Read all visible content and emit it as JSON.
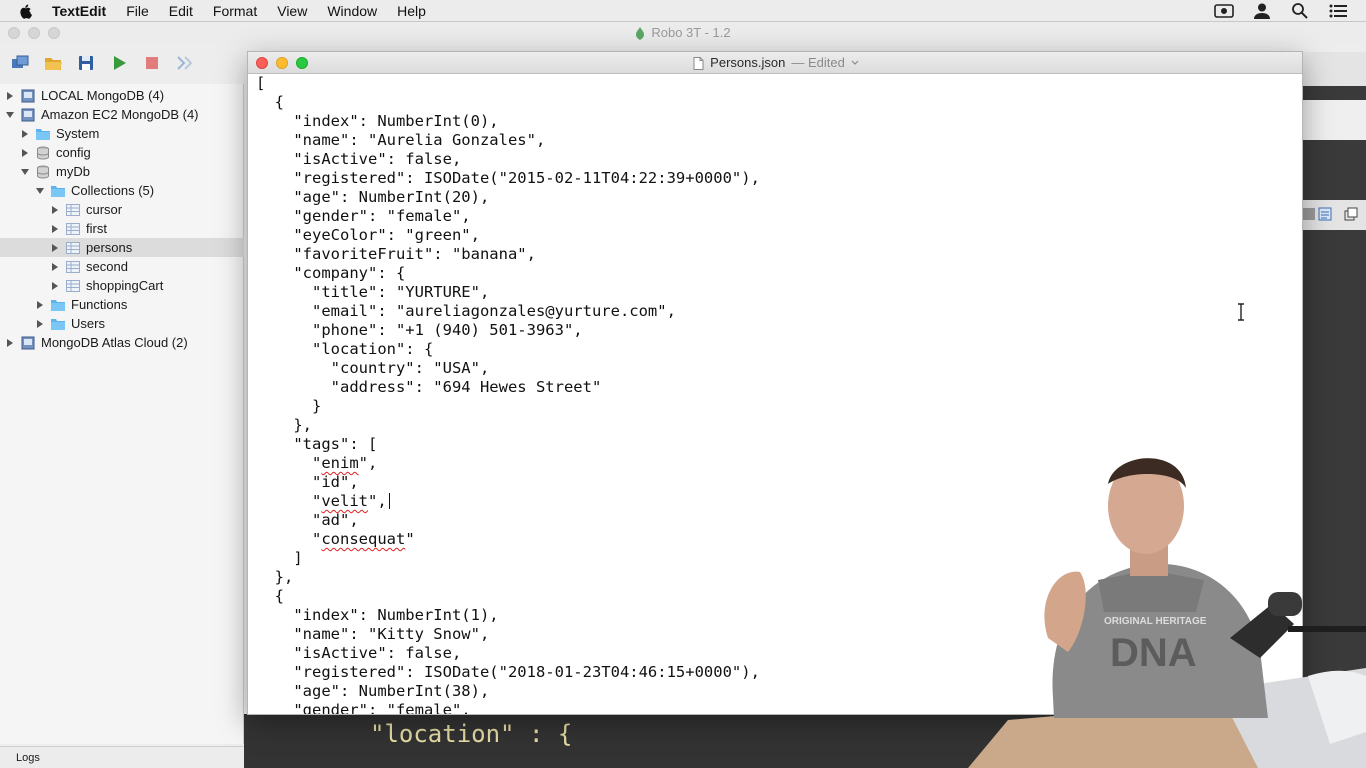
{
  "menubar": {
    "app_name": "TextEdit",
    "items": [
      "File",
      "Edit",
      "Format",
      "View",
      "Window",
      "Help"
    ],
    "right_icons": [
      "screen-record-icon",
      "user-icon",
      "spotlight-search-icon",
      "notification-center-icon"
    ]
  },
  "robo": {
    "title": "Robo 3T - 1.2",
    "toolbar": [
      "connect-icon",
      "open-folder-icon",
      "save-icon",
      "run-icon",
      "stop-icon",
      "shell-icon"
    ],
    "tree": [
      {
        "label": "LOCAL MongoDB (4)",
        "icon": "server-icon",
        "indent": 0,
        "expanded": false
      },
      {
        "label": "Amazon EC2 MongoDB (4)",
        "icon": "server-icon",
        "indent": 0,
        "expanded": true
      },
      {
        "label": "System",
        "icon": "folder-icon",
        "indent": 1,
        "expanded": false
      },
      {
        "label": "config",
        "icon": "database-icon",
        "indent": 1,
        "expanded": false
      },
      {
        "label": "myDb",
        "icon": "database-icon",
        "indent": 1,
        "expanded": true
      },
      {
        "label": "Collections (5)",
        "icon": "folder-icon",
        "indent": 2,
        "expanded": true
      },
      {
        "label": "cursor",
        "icon": "collection-icon",
        "indent": 3,
        "expanded": false
      },
      {
        "label": "first",
        "icon": "collection-icon",
        "indent": 3,
        "expanded": false
      },
      {
        "label": "persons",
        "icon": "collection-icon",
        "indent": 3,
        "expanded": false,
        "selected": true
      },
      {
        "label": "second",
        "icon": "collection-icon",
        "indent": 3,
        "expanded": false
      },
      {
        "label": "shoppingCart",
        "icon": "collection-icon",
        "indent": 3,
        "expanded": false
      },
      {
        "label": "Functions",
        "icon": "folder-icon",
        "indent": 2,
        "expanded": false
      },
      {
        "label": "Users",
        "icon": "folder-icon",
        "indent": 2,
        "expanded": false
      },
      {
        "label": "MongoDB Atlas Cloud (2)",
        "icon": "server-icon",
        "indent": 0,
        "expanded": false
      }
    ],
    "logs_label": "Logs",
    "background_code": "\"location\" : {"
  },
  "textedit": {
    "filename": "Persons.json",
    "status": "— Edited",
    "lines": [
      "[",
      "  {",
      "    \"index\": NumberInt(0),",
      "    \"name\": \"Aurelia Gonzales\",",
      "    \"isActive\": false,",
      "    \"registered\": ISODate(\"2015-02-11T04:22:39+0000\"),",
      "    \"age\": NumberInt(20),",
      "    \"gender\": \"female\",",
      "    \"eyeColor\": \"green\",",
      "    \"favoriteFruit\": \"banana\",",
      "    \"company\": {",
      "      \"title\": \"YURTURE\",",
      "      \"email\": \"aureliagonzales@yurture.com\",",
      "      \"phone\": \"+1 (940) 501-3963\",",
      "      \"location\": {",
      "        \"country\": \"USA\",",
      "        \"address\": \"694 Hewes Street\"",
      "      }",
      "    },",
      "    \"tags\": [",
      "      \"enim\",",
      "      \"id\",",
      "      \"velit\",",
      "      \"ad\",",
      "      \"consequat\"",
      "    ]",
      "  },",
      "  {",
      "    \"index\": NumberInt(1),",
      "    \"name\": \"Kitty Snow\",",
      "    \"isActive\": false,",
      "    \"registered\": ISODate(\"2018-01-23T04:46:15+0000\"),",
      "    \"age\": NumberInt(38),",
      "    \"gender\": \"female\","
    ],
    "misspelled": [
      "enim",
      "velit",
      "consequat"
    ],
    "caret_line": 22
  },
  "presenter_shirt_text": "ORIGINAL HERITAGE"
}
